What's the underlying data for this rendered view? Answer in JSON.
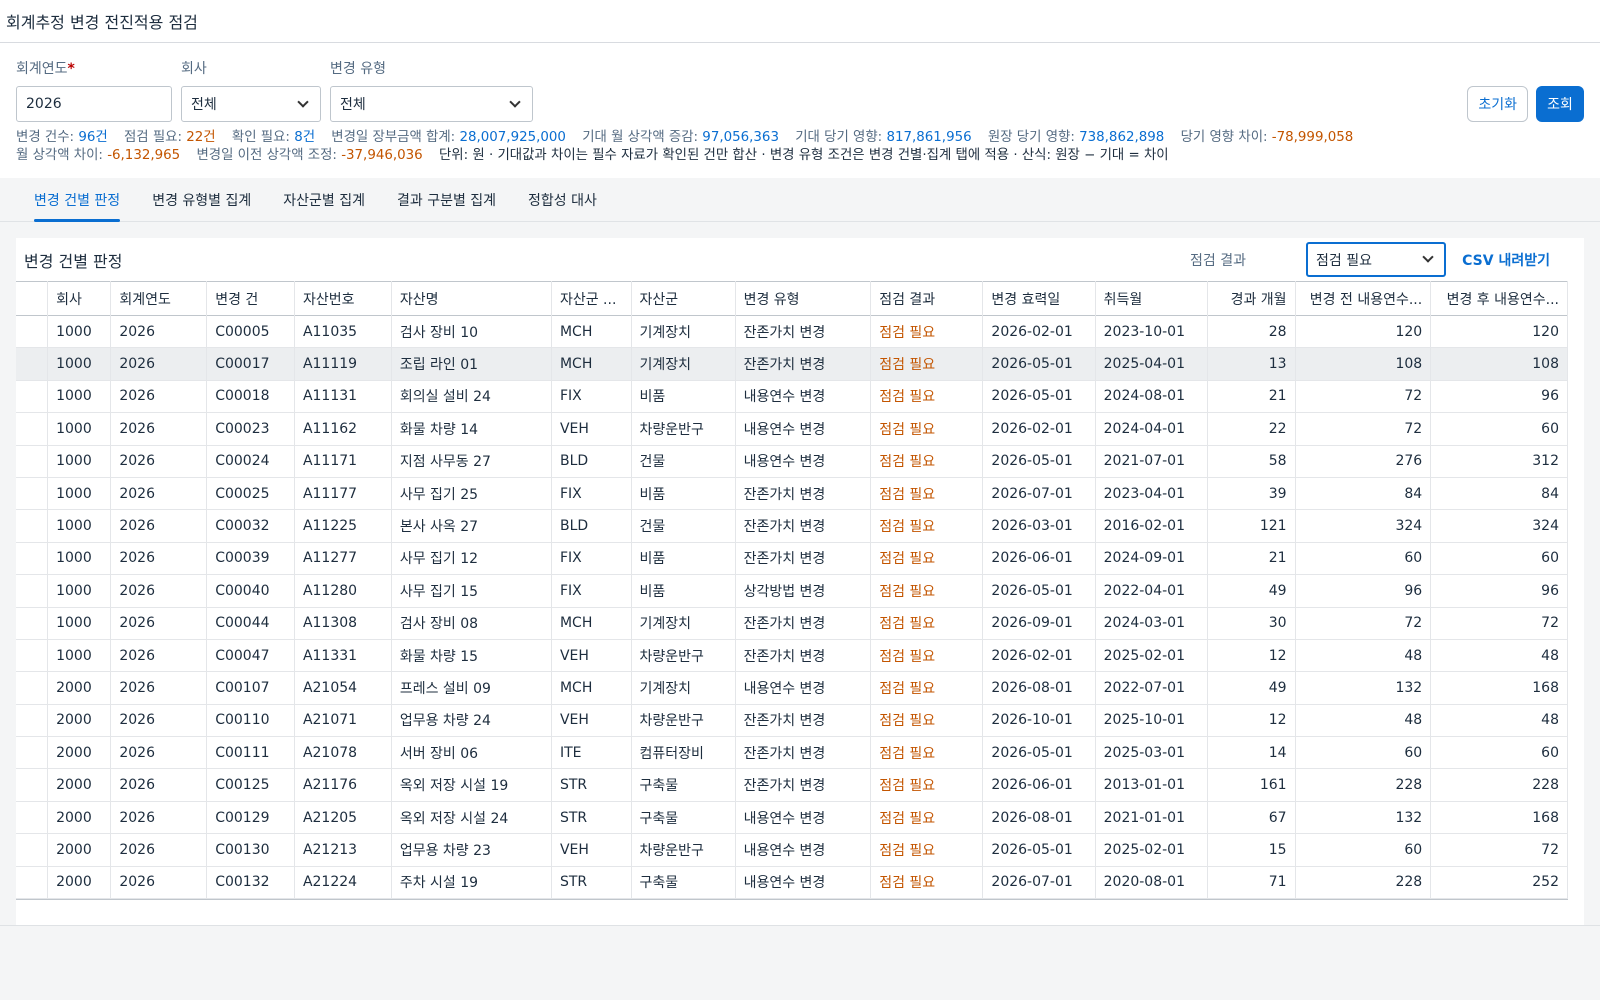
{
  "title": "회계추정 변경 전진적용 점검",
  "filters": {
    "year_label": "회계연도",
    "year_required": "*",
    "year_value": "2026",
    "company_label": "회사",
    "company_value": "전체",
    "change_type_label": "변경 유형",
    "change_type_value": "전체",
    "reset_label": "초기화",
    "search_label": "조회"
  },
  "summary": {
    "count_label": "변경 건수: ",
    "count_value": "96건",
    "need_label": "점검 필요: ",
    "need_value": "22건",
    "confirm_label": "확인 필요: ",
    "confirm_value": "8건",
    "book_label": "변경일 장부금액 합계: ",
    "book_value": "28,007,925,000",
    "monthly_label": "기대 월 상각액 증감: ",
    "monthly_value": "97,056,363",
    "exp_label": "기대 당기 영향: ",
    "exp_value": "817,861,956",
    "ledger_label": "원장 당기 영향: ",
    "ledger_value": "738,862,898",
    "diff_label": "당기 영향 차이: ",
    "diff_value": "-78,999,058",
    "mdiff_label": "월 상각액 차이: ",
    "mdiff_value": "-6,132,965",
    "prior_label": "변경일 이전 상각액 조정: ",
    "prior_value": "-37,946,036",
    "note": "단위: 원 · 기대값과 차이는 필수 자료가 확인된 건만 합산 · 변경 유형 조건은 변경 건별·집계 탭에 적용 · 산식: 원장 − 기대 = 차이"
  },
  "tabs": [
    {
      "label": "변경 건별 판정"
    },
    {
      "label": "변경 유형별 집계"
    },
    {
      "label": "자산군별 집계"
    },
    {
      "label": "결과 구분별 집계"
    },
    {
      "label": "정합성 대사"
    }
  ],
  "panel": {
    "title": "변경 건별 판정",
    "result_filter_label": "점검 결과",
    "result_filter_value": "점검 필요",
    "csv_label": "CSV 내려받기"
  },
  "table": {
    "headers": [
      "회사",
      "회계연도",
      "변경 건",
      "자산번호",
      "자산명",
      "자산군 ...",
      "자산군",
      "변경 유형",
      "점검 결과",
      "변경 효력일",
      "취득월",
      "경과 개월",
      "변경 전 내용연수...",
      "변경 후 내용연수..."
    ],
    "rows": [
      [
        "1000",
        "2026",
        "C00005",
        "A11035",
        "검사 장비 10",
        "MCH",
        "기계장치",
        "잔존가치 변경",
        "점검 필요",
        "2026-02-01",
        "2023-10-01",
        "28",
        "120",
        "120"
      ],
      [
        "1000",
        "2026",
        "C00017",
        "A11119",
        "조립 라인 01",
        "MCH",
        "기계장치",
        "잔존가치 변경",
        "점검 필요",
        "2026-05-01",
        "2025-04-01",
        "13",
        "108",
        "108"
      ],
      [
        "1000",
        "2026",
        "C00018",
        "A11131",
        "회의실 설비 24",
        "FIX",
        "비품",
        "내용연수 변경",
        "점검 필요",
        "2026-05-01",
        "2024-08-01",
        "21",
        "72",
        "96"
      ],
      [
        "1000",
        "2026",
        "C00023",
        "A11162",
        "화물 차량 14",
        "VEH",
        "차량운반구",
        "내용연수 변경",
        "점검 필요",
        "2026-02-01",
        "2024-04-01",
        "22",
        "72",
        "60"
      ],
      [
        "1000",
        "2026",
        "C00024",
        "A11171",
        "지점 사무동 27",
        "BLD",
        "건물",
        "내용연수 변경",
        "점검 필요",
        "2026-05-01",
        "2021-07-01",
        "58",
        "276",
        "312"
      ],
      [
        "1000",
        "2026",
        "C00025",
        "A11177",
        "사무 집기 25",
        "FIX",
        "비품",
        "잔존가치 변경",
        "점검 필요",
        "2026-07-01",
        "2023-04-01",
        "39",
        "84",
        "84"
      ],
      [
        "1000",
        "2026",
        "C00032",
        "A11225",
        "본사 사옥 27",
        "BLD",
        "건물",
        "잔존가치 변경",
        "점검 필요",
        "2026-03-01",
        "2016-02-01",
        "121",
        "324",
        "324"
      ],
      [
        "1000",
        "2026",
        "C00039",
        "A11277",
        "사무 집기 12",
        "FIX",
        "비품",
        "잔존가치 변경",
        "점검 필요",
        "2026-06-01",
        "2024-09-01",
        "21",
        "60",
        "60"
      ],
      [
        "1000",
        "2026",
        "C00040",
        "A11280",
        "사무 집기 15",
        "FIX",
        "비품",
        "상각방법 변경",
        "점검 필요",
        "2026-05-01",
        "2022-04-01",
        "49",
        "96",
        "96"
      ],
      [
        "1000",
        "2026",
        "C00044",
        "A11308",
        "검사 장비 08",
        "MCH",
        "기계장치",
        "잔존가치 변경",
        "점검 필요",
        "2026-09-01",
        "2024-03-01",
        "30",
        "72",
        "72"
      ],
      [
        "1000",
        "2026",
        "C00047",
        "A11331",
        "화물 차량 15",
        "VEH",
        "차량운반구",
        "잔존가치 변경",
        "점검 필요",
        "2026-02-01",
        "2025-02-01",
        "12",
        "48",
        "48"
      ],
      [
        "2000",
        "2026",
        "C00107",
        "A21054",
        "프레스 설비 09",
        "MCH",
        "기계장치",
        "내용연수 변경",
        "점검 필요",
        "2026-08-01",
        "2022-07-01",
        "49",
        "132",
        "168"
      ],
      [
        "2000",
        "2026",
        "C00110",
        "A21071",
        "업무용 차량 24",
        "VEH",
        "차량운반구",
        "잔존가치 변경",
        "점검 필요",
        "2026-10-01",
        "2025-10-01",
        "12",
        "48",
        "48"
      ],
      [
        "2000",
        "2026",
        "C00111",
        "A21078",
        "서버 장비 06",
        "ITE",
        "컴퓨터장비",
        "잔존가치 변경",
        "점검 필요",
        "2026-05-01",
        "2025-03-01",
        "14",
        "60",
        "60"
      ],
      [
        "2000",
        "2026",
        "C00125",
        "A21176",
        "옥외 저장 시설 19",
        "STR",
        "구축물",
        "잔존가치 변경",
        "점검 필요",
        "2026-06-01",
        "2013-01-01",
        "161",
        "228",
        "228"
      ],
      [
        "2000",
        "2026",
        "C00129",
        "A21205",
        "옥외 저장 시설 24",
        "STR",
        "구축물",
        "내용연수 변경",
        "점검 필요",
        "2026-08-01",
        "2021-01-01",
        "67",
        "132",
        "168"
      ],
      [
        "2000",
        "2026",
        "C00130",
        "A21213",
        "업무용 차량 23",
        "VEH",
        "차량운반구",
        "내용연수 변경",
        "점검 필요",
        "2026-05-01",
        "2025-02-01",
        "15",
        "60",
        "72"
      ],
      [
        "2000",
        "2026",
        "C00132",
        "A21224",
        "주차 시설 19",
        "STR",
        "구축물",
        "내용연수 변경",
        "점검 필요",
        "2026-07-01",
        "2020-08-01",
        "71",
        "228",
        "252"
      ]
    ]
  }
}
